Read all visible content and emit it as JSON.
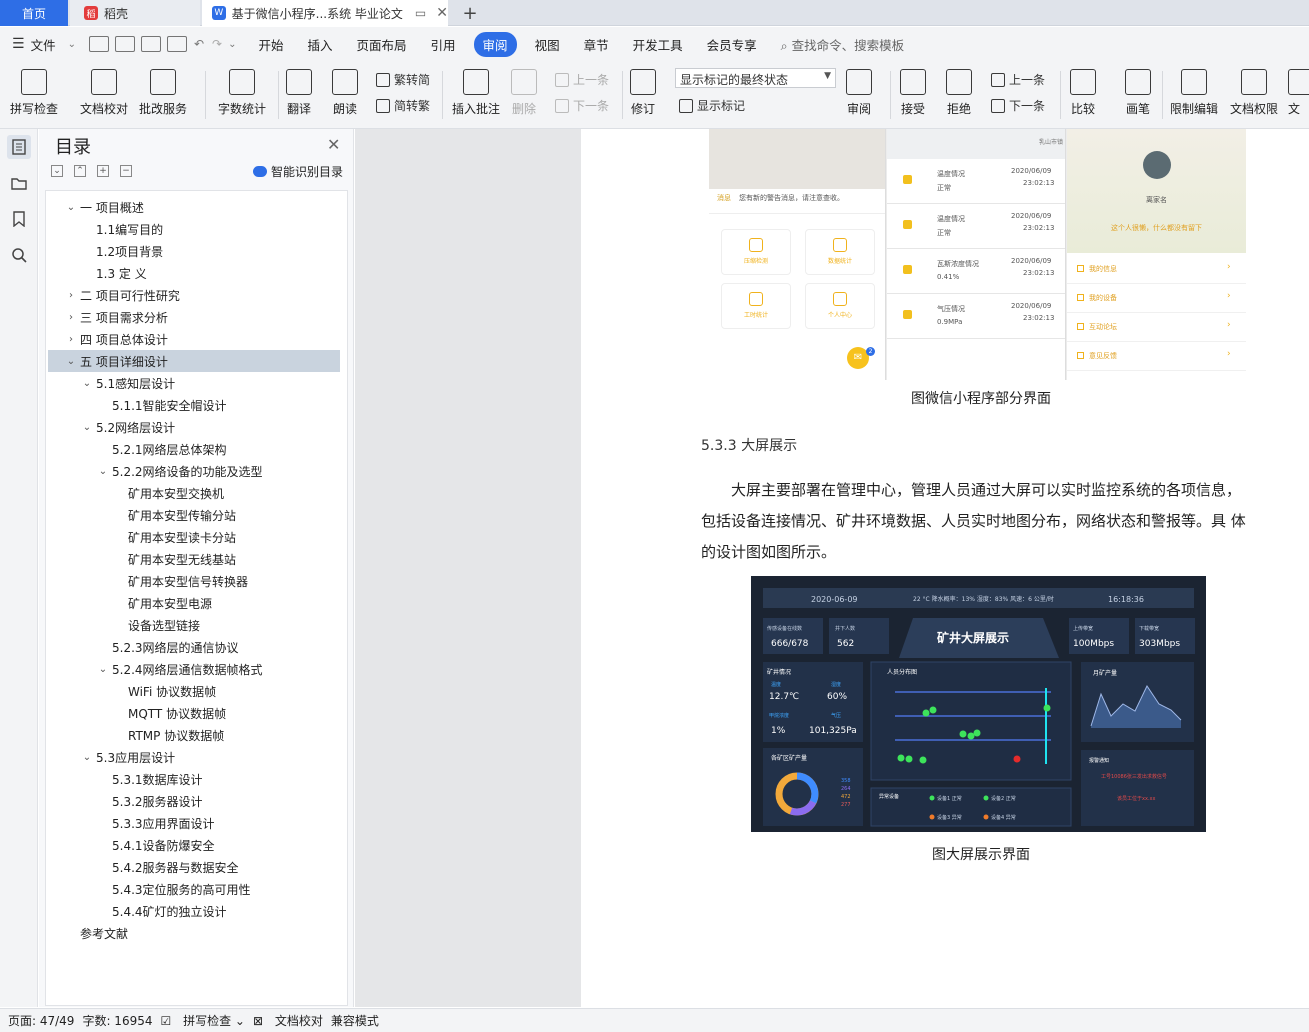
{
  "tabs": {
    "home": "首页",
    "daoke": "稻壳",
    "doc": "基于微信小程序...系统 毕业论文"
  },
  "menu": {
    "file": "文件",
    "items": [
      "开始",
      "插入",
      "页面布局",
      "引用",
      "审阅",
      "视图",
      "章节",
      "开发工具",
      "会员专享"
    ],
    "active_index": 4,
    "search": "查找命令、搜索模板"
  },
  "ribbon": {
    "spell": "拼写检查",
    "proof": "文档校对",
    "batch": "批改服务",
    "wordcount": "字数统计",
    "translate": "翻译",
    "read": "朗读",
    "t2s": "繁转简",
    "s2t": "简转繁",
    "insert_comment": "插入批注",
    "delete": "删除",
    "prev1": "上一条",
    "next1": "下一条",
    "track": "修订",
    "markstate": "显示标记的最终状态",
    "showmark": "显示标记",
    "review": "审阅",
    "accept": "接受",
    "reject": "拒绝",
    "prev2": "上一条",
    "next2": "下一条",
    "compare": "比较",
    "pen": "画笔",
    "restrict": "限制编辑",
    "perm": "文档权限",
    "more": "文"
  },
  "toc": {
    "title": "目录",
    "smart": "智能识别目录",
    "items": [
      {
        "t": "一 项目概述",
        "lv": 1,
        "arrow": "open"
      },
      {
        "t": "1.1编写目的",
        "lv": 2
      },
      {
        "t": "1.2项目背景",
        "lv": 2
      },
      {
        "t": "1.3 定 义",
        "lv": 2
      },
      {
        "t": "二 项目可行性研究",
        "lv": 1,
        "arrow": "closed"
      },
      {
        "t": "三 项目需求分析",
        "lv": 1,
        "arrow": "closed"
      },
      {
        "t": "四 项目总体设计",
        "lv": 1,
        "arrow": "closed"
      },
      {
        "t": "五 项目详细设计",
        "lv": 1,
        "arrow": "open",
        "sel": true
      },
      {
        "t": "5.1感知层设计",
        "lv": 2,
        "arrow": "open"
      },
      {
        "t": "5.1.1智能安全帽设计",
        "lv": 3
      },
      {
        "t": "5.2网络层设计",
        "lv": 2,
        "arrow": "open"
      },
      {
        "t": "5.2.1网络层总体架构",
        "lv": 3
      },
      {
        "t": "5.2.2网络设备的功能及选型",
        "lv": 3,
        "arrow": "open"
      },
      {
        "t": "矿用本安型交换机",
        "lv": 4
      },
      {
        "t": "矿用本安型传输分站",
        "lv": 4
      },
      {
        "t": "矿用本安型读卡分站",
        "lv": 4
      },
      {
        "t": "矿用本安型无线基站",
        "lv": 4
      },
      {
        "t": "矿用本安型信号转换器",
        "lv": 4
      },
      {
        "t": "矿用本安型电源",
        "lv": 4
      },
      {
        "t": "设备选型链接",
        "lv": 4
      },
      {
        "t": "5.2.3网络层的通信协议",
        "lv": 3
      },
      {
        "t": "5.2.4网络层通信数据帧格式",
        "lv": 3,
        "arrow": "open"
      },
      {
        "t": "WiFi 协议数据帧",
        "lv": 4
      },
      {
        "t": "MQTT 协议数据帧",
        "lv": 4
      },
      {
        "t": "RTMP 协议数据帧",
        "lv": 4
      },
      {
        "t": "5.3应用层设计",
        "lv": 2,
        "arrow": "open"
      },
      {
        "t": "5.3.1数据库设计",
        "lv": 3
      },
      {
        "t": "5.3.2服务器设计",
        "lv": 3
      },
      {
        "t": "5.3.3应用界面设计",
        "lv": 3
      },
      {
        "t": "5.4.1设备防爆安全",
        "lv": 3
      },
      {
        "t": "5.4.2服务器与数据安全",
        "lv": 3
      },
      {
        "t": "5.4.3定位服务的高可用性",
        "lv": 3
      },
      {
        "t": "5.4.4矿灯的独立设计",
        "lv": 3
      },
      {
        "t": "参考文献",
        "lv": 1
      }
    ]
  },
  "doc": {
    "caption1": "图微信小程序部分界面",
    "section": "5.3.3  大屏展示",
    "para1": "大屏主要部署在管理中心，管理人员通过大屏可以实时监控系统的各项信息，",
    "para2": "包括设备连接情况、矿井环境数据、人员实时地图分布，网络状态和警报等。具 体",
    "para3": "的设计图如图所示。",
    "caption2": "图大屏展示界面"
  },
  "phones": {
    "msg_label": "消息",
    "msg": "您有新的警告消息，请注意查收。",
    "grid": [
      "压缩检测",
      "数据统计",
      "工时统计",
      "个人中心"
    ],
    "badge": "2",
    "alerts": [
      {
        "name": "温度情况",
        "val": "正常",
        "date": "2020/06/09",
        "time": "23:02:13"
      },
      {
        "name": "温度情况",
        "val": "正常",
        "date": "2020/06/09",
        "time": "23:02:13"
      },
      {
        "name": "瓦斯浓度情况",
        "val": "0.41%",
        "date": "2020/06/09",
        "time": "23:02:13"
      },
      {
        "name": "气压情况",
        "val": "0.9MPa",
        "date": "2020/06/09",
        "time": "23:02:13"
      }
    ],
    "map_label": "乳山市镇",
    "username": "离家名",
    "slogan": "这个人很懒，什么都没有留下",
    "menu": [
      "我的信息",
      "我的设备",
      "互动论坛",
      "意见反馈"
    ]
  },
  "screen": {
    "date": "2020-06-09",
    "weather": "22 °C 降水概率：13% 湿度：83% 风速：6 公里/时",
    "time": "16:18:36",
    "title": "矿井大屏展示",
    "online_label": "传感设备在线数",
    "online": "666/678",
    "workers_label": "井下人数",
    "workers": "562",
    "up_label": "上传带宽",
    "up": "100Mbps",
    "down_label": "下载带宽",
    "down": "303Mbps",
    "mine_label": "矿井情况",
    "temp_label": "温度",
    "temp": "12.7℃",
    "hum_label": "湿度",
    "hum": "60%",
    "gas_label": "甲烷浓度",
    "gas": "1%",
    "press_label": "气压",
    "press": "101,325Pa",
    "dist_label": "人员分布图",
    "prod_label": "月矿产量",
    "area_label": "各矿区矿产量",
    "pie_vals": [
      "358",
      "264",
      "472",
      "277"
    ],
    "alarm_label": "报警通知",
    "alarm1": "工号10086张三发出求救信号",
    "alarm2": "该员工位于xx.xx",
    "device_label": "异常设备",
    "devices": [
      "设备1 正常",
      "设备2 正常",
      "设备3 异常",
      "设备4 异常"
    ]
  },
  "status": {
    "page": "页面: 47/49",
    "words": "字数: 16954",
    "spell": "拼写检查",
    "proof": "文档校对",
    "compat": "兼容模式"
  }
}
